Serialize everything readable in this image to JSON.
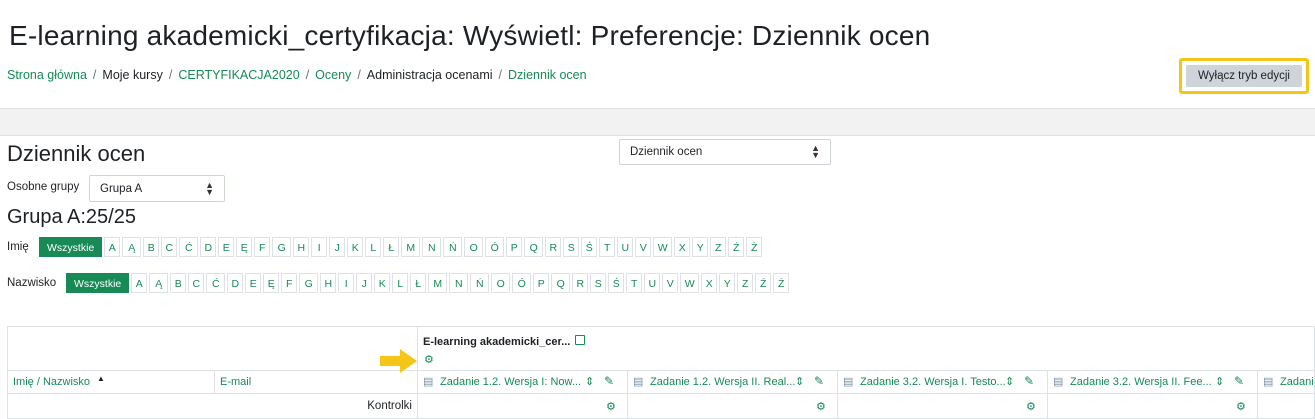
{
  "page_title": "E-learning akademicki_certyfikacja: Wyświetl: Preferencje: Dziennik ocen",
  "breadcrumb": [
    {
      "label": "Strona główna",
      "link": true
    },
    {
      "label": "Moje kursy",
      "link": false
    },
    {
      "label": "CERTYFIKACJA2020",
      "link": true
    },
    {
      "label": "Oceny",
      "link": true
    },
    {
      "label": "Administracja ocenami",
      "link": false
    },
    {
      "label": "Dziennik ocen",
      "link": true
    }
  ],
  "edit_button": "Wyłącz tryb edycji",
  "section_title": "Dziennik ocen",
  "view_select": "Dziennik ocen",
  "groups_label": "Osobne grupy",
  "group_select": "Grupa A",
  "group_count": "Grupa A:25/25",
  "first_name_label": "Imię",
  "last_name_label": "Nazwisko",
  "all_label": "Wszystkie",
  "letters": [
    "A",
    "Ą",
    "B",
    "C",
    "Ć",
    "D",
    "E",
    "Ę",
    "F",
    "G",
    "H",
    "I",
    "J",
    "K",
    "L",
    "Ł",
    "M",
    "N",
    "Ń",
    "O",
    "Ó",
    "P",
    "Q",
    "R",
    "S",
    "Ś",
    "T",
    "U",
    "V",
    "W",
    "X",
    "Y",
    "Z",
    "Ź",
    "Ż"
  ],
  "table": {
    "course_header": "E-learning akademicki_cer...",
    "col_name": "Imię / Nazwisko",
    "col_email": "E-mail",
    "assignments": [
      "Zadanie 1.2. Wersja I: Now...",
      "Zadanie 1.2. Wersja II. Real...",
      "Zadanie 3.2. Wersja I. Testo...",
      "Zadanie 3.2. Wersja II. Fee...",
      "Zadani"
    ],
    "controls_label": "Kontrolki"
  },
  "colors": {
    "accent": "#178a55",
    "highlight": "#f5c518"
  }
}
